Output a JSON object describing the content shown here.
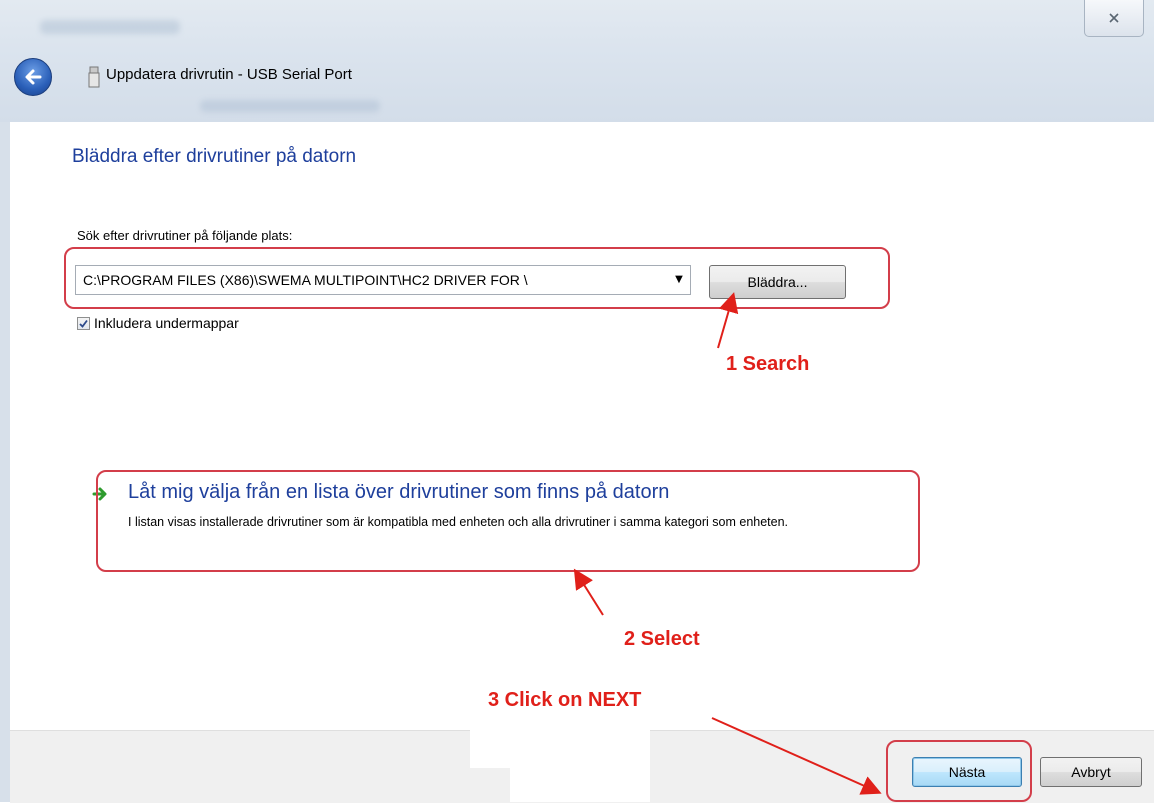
{
  "window": {
    "title": "Uppdatera drivrutin - USB Serial Port",
    "close_icon": "close-icon",
    "back_icon": "back-arrow-icon"
  },
  "main": {
    "heading": "Bläddra efter drivrutiner på datorn",
    "search_location_label": "Sök efter drivrutiner på följande plats:",
    "path_value": "C:\\PROGRAM FILES (X86)\\SWEMA MULTIPOINT\\HC2 DRIVER FOR \\",
    "browse_label": "Bläddra...",
    "include_subfolders_label": "Inkludera undermappar",
    "include_subfolders_checked": true,
    "pick_option_title": "Låt mig välja från en lista över drivrutiner som finns på datorn",
    "pick_option_desc": "I listan visas installerade drivrutiner som är kompatibla med enheten och alla drivrutiner i samma kategori som enheten."
  },
  "annotations": {
    "step1": "1 Search",
    "step2": "2 Select",
    "step3": "3 Click on NEXT",
    "color": "#e0201a"
  },
  "footer": {
    "next_label": "Nästa",
    "cancel_label": "Avbryt"
  }
}
